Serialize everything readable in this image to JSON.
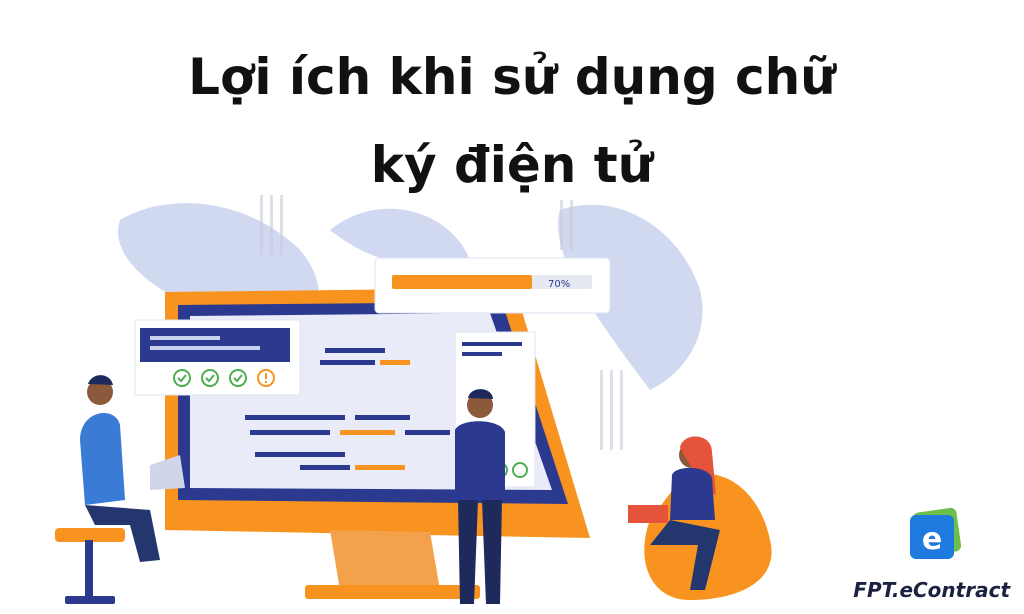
{
  "heading": {
    "line1": "Lợi ích khi sử dụng chữ",
    "line2": "ký điện tử"
  },
  "progress": {
    "label": "70%",
    "value": 0.7
  },
  "checklist": {
    "checked": 3,
    "warnings": 1
  },
  "brand": {
    "name": "FPT.eContract",
    "icon": "e-letter-icon",
    "icon_letter": "e"
  },
  "colors": {
    "accent_orange": "#f7931e",
    "navy": "#2b3a8f",
    "leaf": "#c9d2ef",
    "text": "#111111"
  }
}
